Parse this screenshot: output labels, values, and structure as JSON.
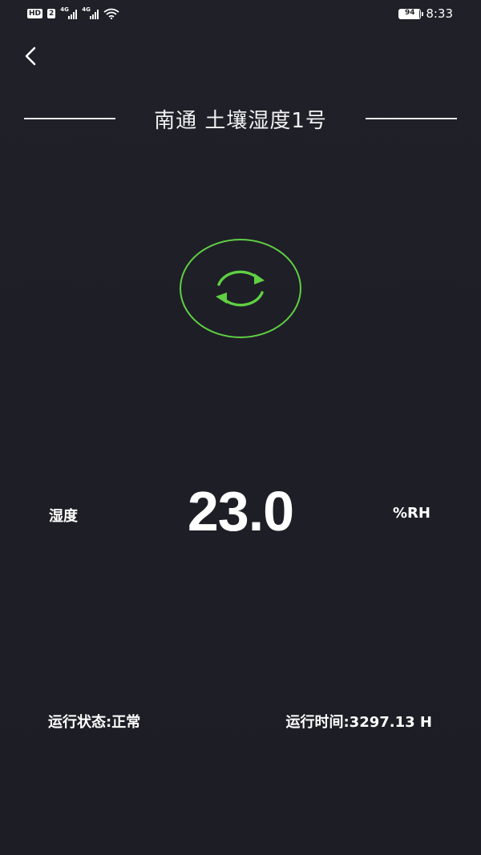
{
  "status_bar": {
    "hd_label": "HD",
    "sim_label": "2",
    "network_1": "4G",
    "network_2": "4G",
    "wifi_icon": "wifi-icon",
    "battery_level": 94,
    "battery_text": "94",
    "time": "8:33"
  },
  "header": {
    "back_icon": "chevron-left-icon",
    "title": "南通 土壤湿度1号"
  },
  "refresh": {
    "icon": "refresh-icon",
    "accent_color": "#5fd043"
  },
  "reading": {
    "label": "湿度",
    "value": "23.0",
    "unit": "%RH"
  },
  "footer": {
    "run_status": "运行状态:正常",
    "run_time": "运行时间:3297.13 H"
  },
  "colors": {
    "background": "#1f1f27",
    "text": "#ffffff",
    "accent": "#5fd043"
  }
}
